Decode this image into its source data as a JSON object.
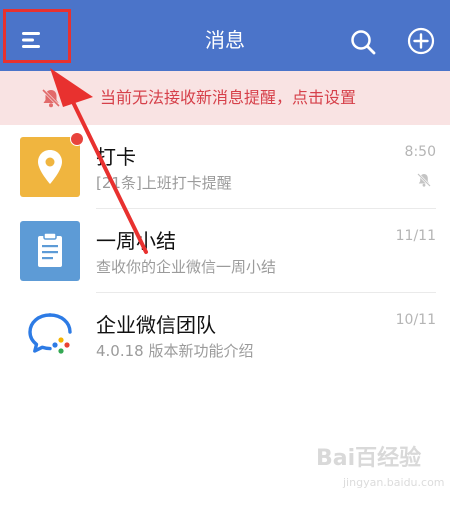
{
  "header": {
    "title": "消息"
  },
  "notice": {
    "text": "当前无法接收新消息提醒，点击设置"
  },
  "conversations": [
    {
      "name": "打卡",
      "preview": "[21条]上班打卡提醒",
      "time": "8:50",
      "muted": true,
      "unread_dot": true
    },
    {
      "name": "一周小结",
      "preview": "查收你的企业微信一周小结",
      "time": "11/11"
    },
    {
      "name": "企业微信团队",
      "preview": "4.0.18 版本新功能介绍",
      "time": "10/11"
    }
  ],
  "watermark": {
    "main": "Bai百经验",
    "sub": "jingyan.baidu.com"
  },
  "colors": {
    "header": "#4b74c9",
    "notice_bg": "#f9e3e3",
    "notice_text": "#d6404a",
    "annotation": "#e8312f"
  }
}
